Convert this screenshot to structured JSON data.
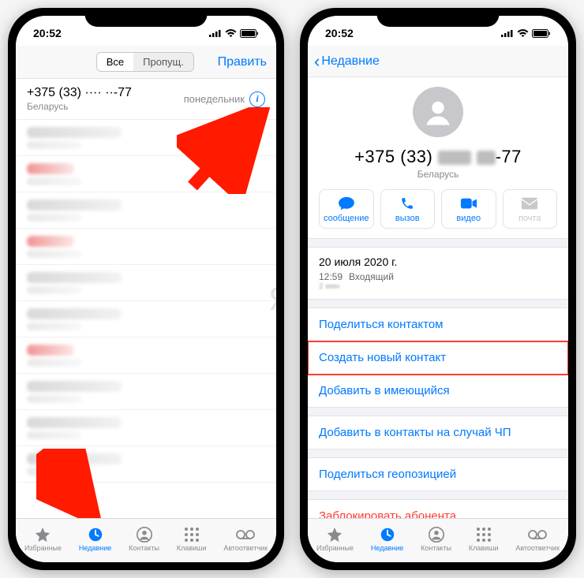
{
  "status": {
    "time": "20:52"
  },
  "left": {
    "segmented": {
      "all": "Все",
      "missed": "Пропущ."
    },
    "edit": "Править",
    "top_call": {
      "number": "+375 (33) ···· ··-77",
      "country": "Беларусь",
      "when": "понедельник"
    }
  },
  "tabs": {
    "fav": "Избранные",
    "recent": "Недавние",
    "contacts": "Контакты",
    "keypad": "Клавиши",
    "voicemail": "Автоответчик"
  },
  "right": {
    "back": "Недавние",
    "number_prefix": "+375 (33) ",
    "number_suffix": "-77",
    "country": "Беларусь",
    "actions": {
      "message": "сообщение",
      "call": "вызов",
      "video": "видео",
      "mail": "почта"
    },
    "date": "20 июля 2020 г.",
    "time": "12:59",
    "direction": "Входящий",
    "duration": "2 мин",
    "share_contact": "Поделиться контактом",
    "create_new": "Создать новый контакт",
    "add_existing": "Добавить в имеющийся",
    "add_emergency": "Добавить в контакты на случай ЧП",
    "share_location": "Поделиться геопозицией",
    "block": "Заблокировать абонента"
  },
  "watermark": "ЯБЛЫК"
}
